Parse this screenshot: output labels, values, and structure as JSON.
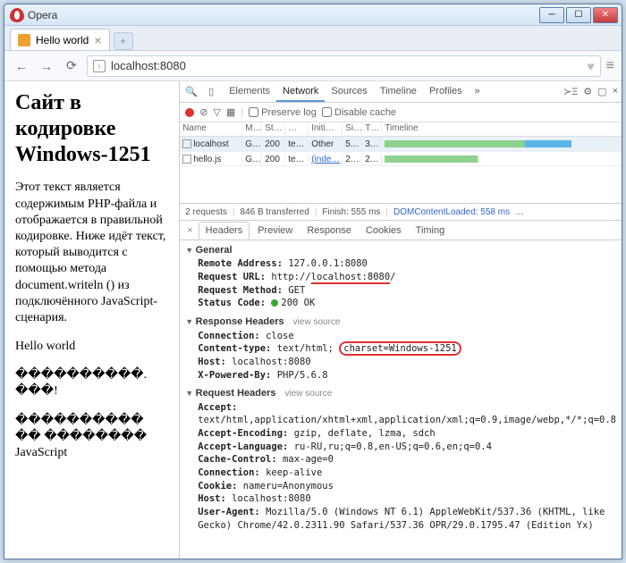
{
  "window": {
    "title": "Opera"
  },
  "tab": {
    "title": "Hello world"
  },
  "url": "localhost:8080",
  "page": {
    "heading": "Сайт в кодировке Windows-1251",
    "para1": "Этот текст является содержимым PHP-файла и отображается в правильной кодировке. Ниже идёт текст, который выводится с помощью метода document.writeln () из подключённого JavaScript-сценария.",
    "para2": "Hello world",
    "para3": "����������. ���!",
    "para4": "���������� �� �������� JavaScript"
  },
  "devtools": {
    "tabs": [
      "Elements",
      "Network",
      "Sources",
      "Timeline",
      "Profiles"
    ],
    "active_tab": "Network",
    "options": {
      "preserve_log": "Preserve log",
      "disable_cache": "Disable cache"
    },
    "columns": [
      "Name",
      "M…",
      "St…",
      "…",
      "Initi…",
      "Si…",
      "T…",
      "Timeline"
    ],
    "rows": [
      {
        "name": "localhost",
        "method": "G…",
        "status": "200",
        "type": "te…",
        "initiator": "Other",
        "size": "5…",
        "time": "3…"
      },
      {
        "name": "hello.js",
        "method": "G…",
        "status": "200",
        "type": "te…",
        "initiator": "(inde…",
        "size": "2…",
        "time": "2…"
      }
    ],
    "summary": {
      "requests": "2 requests",
      "transferred": "846 B transferred",
      "finish": "Finish: 555 ms",
      "dcl": "DOMContentLoaded: 558 ms",
      "more": "…"
    },
    "detail_tabs": [
      "Headers",
      "Preview",
      "Response",
      "Cookies",
      "Timing"
    ],
    "detail_active": "Headers",
    "general": {
      "title": "General",
      "remote_label": "Remote Address:",
      "remote": "127.0.0.1:8080",
      "url_label": "Request URL:",
      "url_pre": "http://",
      "url_hl": "localhost:8080",
      "url_post": "/",
      "method_label": "Request Method:",
      "method": "GET",
      "status_label": "Status Code:",
      "status": "200 OK"
    },
    "resp_headers": {
      "title": "Response Headers",
      "view_source": "view source",
      "items": [
        {
          "k": "Connection:",
          "v": "close"
        },
        {
          "k": "Content-type:",
          "v_pre": "text/html",
          "v_hl": "charset=Windows-1251"
        },
        {
          "k": "Host:",
          "v": "localhost:8080"
        },
        {
          "k": "X-Powered-By:",
          "v": "PHP/5.6.8"
        }
      ]
    },
    "req_headers": {
      "title": "Request Headers",
      "view_source": "view source",
      "items": [
        {
          "k": "Accept:",
          "v": "text/html,application/xhtml+xml,application/xml;q=0.9,image/webp,*/*;q=0.8"
        },
        {
          "k": "Accept-Encoding:",
          "v": "gzip, deflate, lzma, sdch"
        },
        {
          "k": "Accept-Language:",
          "v": "ru-RU,ru;q=0.8,en-US;q=0.6,en;q=0.4"
        },
        {
          "k": "Cache-Control:",
          "v": "max-age=0"
        },
        {
          "k": "Connection:",
          "v": "keep-alive"
        },
        {
          "k": "Cookie:",
          "v": "nameru=Anonymous"
        },
        {
          "k": "Host:",
          "v": "localhost:8080"
        },
        {
          "k": "User-Agent:",
          "v": "Mozilla/5.0 (Windows NT 6.1) AppleWebKit/537.36 (KHTML, like Gecko) Chrome/42.0.2311.90 Safari/537.36 OPR/29.0.1795.47 (Edition Yx)"
        }
      ]
    }
  }
}
